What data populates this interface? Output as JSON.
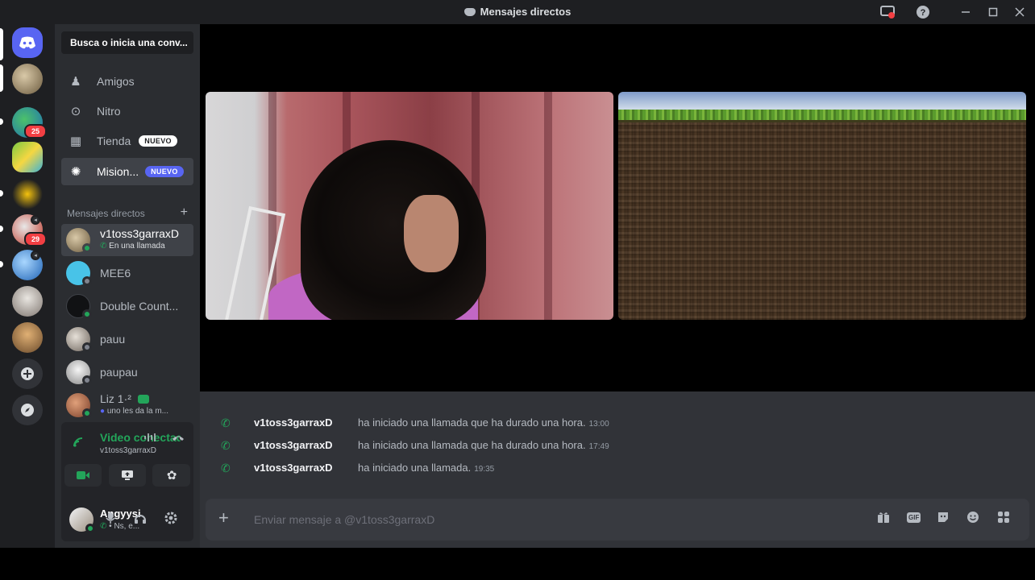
{
  "window": {
    "title": "Mensajes directos"
  },
  "servers": {
    "badges": [
      "25",
      "29"
    ]
  },
  "sidebar": {
    "search_label": "Busca o inicia una conv...",
    "nav": [
      {
        "label": "Amigos",
        "icon": "friends-icon"
      },
      {
        "label": "Nitro",
        "icon": "nitro-icon"
      },
      {
        "label": "Tienda",
        "icon": "shop-icon",
        "badge": "NUEVO"
      },
      {
        "label": "Mision...",
        "icon": "quests-icon",
        "badge": "NUEVO"
      }
    ],
    "dm_header": "Mensajes directos",
    "dms": [
      {
        "name": "v1toss3garraxD",
        "sub": "En una llamada"
      },
      {
        "name": "MEE6"
      },
      {
        "name": "Double Count..."
      },
      {
        "name": "pauu"
      },
      {
        "name": "paupau"
      },
      {
        "name": "Liz 1·²",
        "sub": "uno les da la m..."
      }
    ]
  },
  "voice": {
    "title": "Video conectad",
    "subtitle": "v1toss3garraxD"
  },
  "user": {
    "name": "Angyysi",
    "status": "• Ns, e..."
  },
  "messages": [
    {
      "author": "v1toss3garraxD",
      "text": "ha iniciado una llamada que ha durado una hora.",
      "time": "13:00"
    },
    {
      "author": "v1toss3garraxD",
      "text": "ha iniciado una llamada que ha durado una hora.",
      "time": "17:49"
    },
    {
      "author": "v1toss3garraxD",
      "text": "ha iniciado una llamada.",
      "time": "19:35"
    }
  ],
  "composer": {
    "placeholder": "Enviar mensaje a @v1toss3garraxD",
    "gif_label": "GIF"
  },
  "colors": {
    "accent": "#5865f2",
    "online": "#23a55a",
    "danger": "#f23f43"
  }
}
